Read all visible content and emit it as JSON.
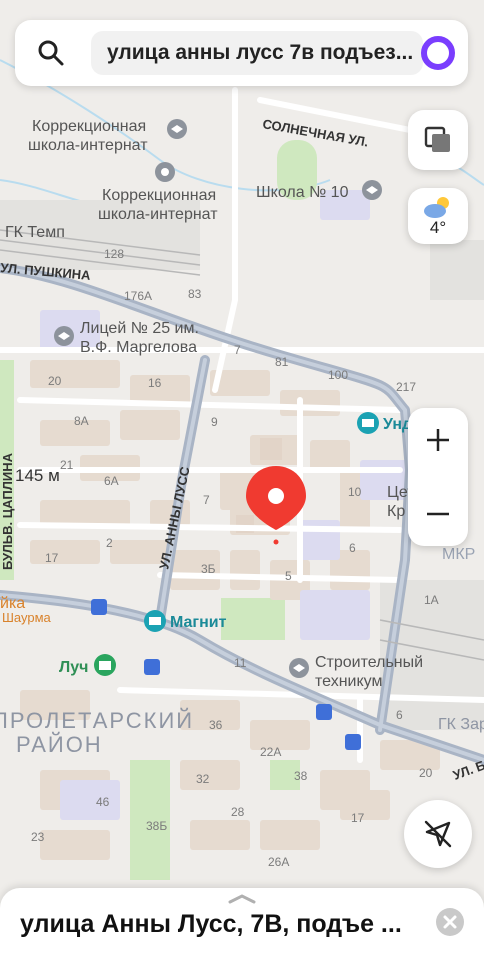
{
  "search": {
    "value": "улица анны лусс 7в подъез..."
  },
  "weather": {
    "temp": "4°"
  },
  "scale": {
    "label": "145 м"
  },
  "bottom_sheet": {
    "title": "улица Анны Лусс, 7В, подъе ..."
  },
  "map": {
    "streets": [
      "СОЛНЕЧНАЯ УЛ.",
      "УЛ. ПУШКИНА",
      "УЛ. АННЫ ЛУСС",
      "БУЛЬВ. ЦАПЛИНА",
      "УЛ. Б"
    ],
    "districts": [
      "ПРОЛЕТАРСКИЙ",
      "РАЙОН"
    ],
    "pois": [
      {
        "name": "Коррекционная школа-интернат",
        "lines": [
          "Коррекционная",
          "школа-интернат"
        ]
      },
      {
        "name": "Коррекционная школа-интернат",
        "lines": [
          "Коррекционная",
          "школа-интернат"
        ]
      },
      {
        "name": "Школа № 10",
        "lines": [
          "Школа № 10"
        ]
      },
      {
        "name": "ГК Темп",
        "lines": [
          "ГК Темп"
        ]
      },
      {
        "name": "Лицей № 25 им. В.Ф. Маргелова",
        "lines": [
          "Лицей № 25 им.",
          "В.Ф. Маргелова"
        ]
      },
      {
        "name": "Магнит",
        "lines": [
          "Магнит"
        ]
      },
      {
        "name": "Луч",
        "lines": [
          "Луч"
        ]
      },
      {
        "name": "Строительный техникум",
        "lines": [
          "Строительный",
          "техникум"
        ]
      },
      {
        "name": "Унд",
        "lines": [
          "Унд"
        ]
      },
      {
        "name": "Цетком Кр",
        "lines": [
          "Цетком",
          "Кр"
        ]
      },
      {
        "name": "МКР",
        "lines": [
          "МКР"
        ]
      },
      {
        "name": "ГК Зар",
        "lines": [
          "ГК Зар"
        ]
      },
      {
        "name": "Шаурма",
        "lines": [
          "Шаурма"
        ]
      },
      {
        "name": "йка",
        "lines": [
          "йка"
        ]
      }
    ],
    "house_numbers": [
      "128",
      "176А",
      "83",
      "7",
      "81",
      "100",
      "217",
      "20",
      "16",
      "9",
      "8А",
      "21",
      "6А",
      "7",
      "10",
      "2",
      "3Б",
      "5",
      "6",
      "17",
      "1А",
      "11",
      "36",
      "22А",
      "6",
      "46",
      "32",
      "38",
      "20",
      "23",
      "38Б",
      "28",
      "26А",
      "17"
    ]
  },
  "colors": {
    "map_bg": "#efedea",
    "road": "#a9b4c5",
    "building": "#e6dbd0",
    "park": "#cfe8bf",
    "marker": "#f03a30",
    "water": "#b9dcef",
    "poi_icon": "#8d939c",
    "shop_icon": "#1ba2b3",
    "culture_icon": "#2aa55e",
    "transit_icon": "#3f6fd8",
    "alice_purple": "#7a3dfe"
  }
}
